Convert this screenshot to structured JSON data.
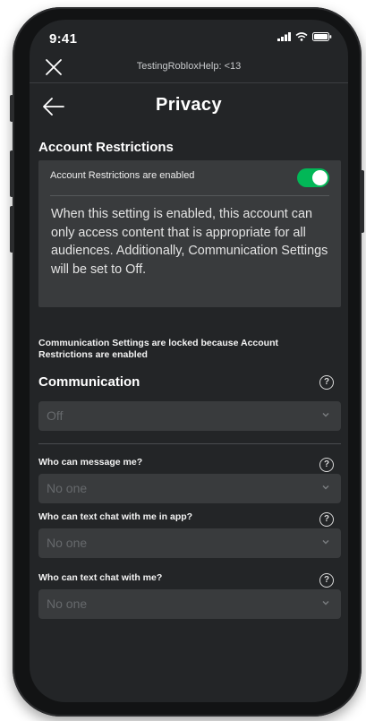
{
  "status_bar": {
    "time": "9:41"
  },
  "topbar": {
    "title": "TestingRobloxHelp: <13"
  },
  "header": {
    "title": "Privacy"
  },
  "account_restrictions": {
    "section_title": "Account Restrictions",
    "toggle_label": "Account Restrictions are enabled",
    "toggle_on": true,
    "description": "When this setting is enabled, this account can only access content that is appropriate for all audiences. Additionally, Communication Settings will be set to Off."
  },
  "communication": {
    "locked_note": "Communication Settings are locked because Account Restrictions are enabled",
    "title": "Communication",
    "help_symbol": "?",
    "preset_value": "Off",
    "fields": [
      {
        "label": "Who can message me?",
        "value": "No one"
      },
      {
        "label": "Who can text chat with me in app?",
        "value": "No one"
      },
      {
        "label": "Who can text chat with me?",
        "value": "No one"
      }
    ]
  },
  "colors": {
    "screen_bg": "#232527",
    "panel_bg": "#393b3d",
    "toggle_on": "#02b757",
    "disabled_text": "#66696c"
  },
  "icons": [
    "close-icon",
    "back-arrow-icon",
    "signal-icon",
    "wifi-icon",
    "battery-icon",
    "help-icon",
    "chevron-down-icon"
  ]
}
